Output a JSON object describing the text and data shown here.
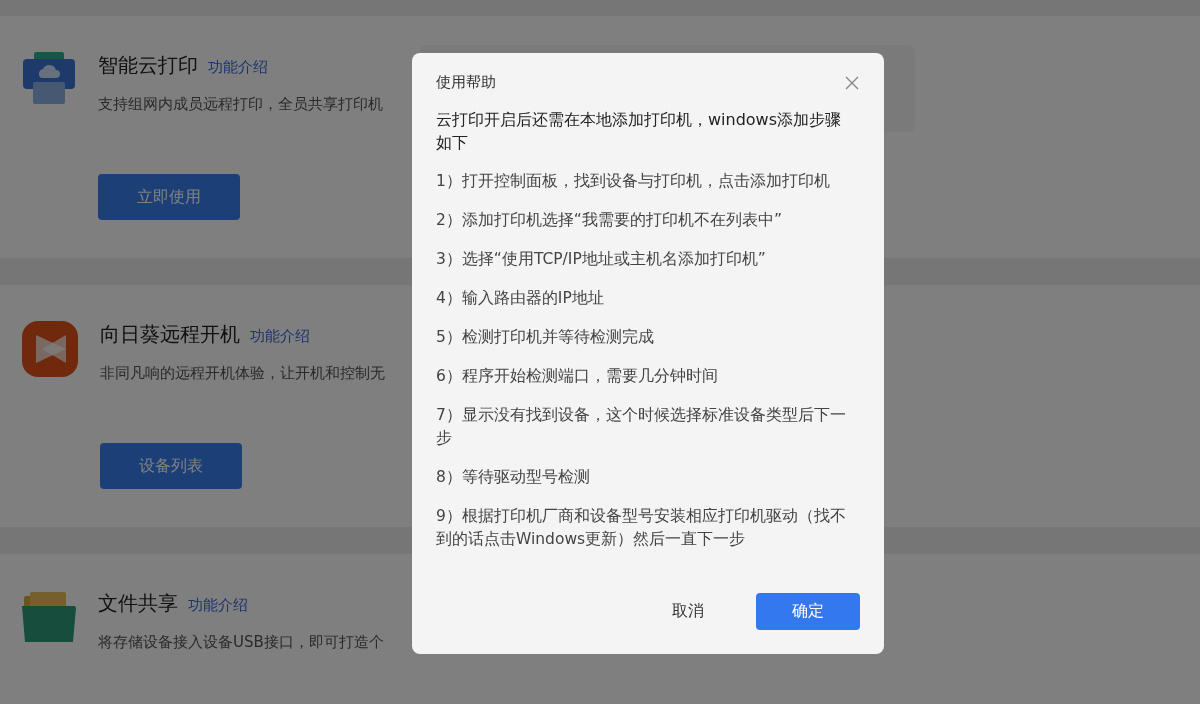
{
  "features": [
    {
      "kind": "printer",
      "title": "智能云打印",
      "link": "功能介绍",
      "description": "支持组网内成员远程打印，全员共享打印机",
      "button": "立即使用"
    },
    {
      "kind": "remote",
      "title": "向日葵远程开机",
      "link": "功能介绍",
      "description": "非同凡响的远程开机体验，让开机和控制无",
      "button": "设备列表"
    },
    {
      "kind": "folder",
      "title": "文件共享",
      "link": "功能介绍",
      "description": "将存储设备接入设备USB接口，即可打造个"
    }
  ],
  "dialog": {
    "title": "使用帮助",
    "intro": "云打印开启后还需在本地添加打印机，windows添加步骤如下",
    "steps": [
      "1）打开控制面板，找到设备与打印机，点击添加打印机",
      "2）添加打印机选择“我需要的打印机不在列表中”",
      "3）选择“使用TCP/IP地址或主机名添加打印机”",
      "4）输入路由器的IP地址",
      "5）检测打印机并等待检测完成",
      "6）程序开始检测端口，需要几分钟时间",
      "7）显示没有找到设备，这个时候选择标准设备类型后下一步",
      "8）等待驱动型号检测",
      "9）根据打印机厂商和设备型号安装相应打印机驱动（找不到的话点击Windows更新）然后一直下一步"
    ],
    "cancel": "取消",
    "confirm": "确定"
  }
}
